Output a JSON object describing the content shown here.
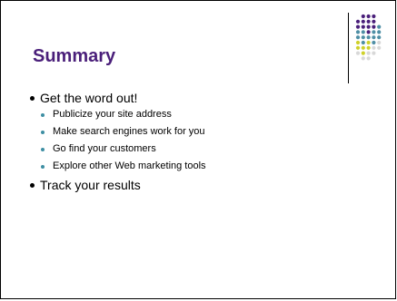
{
  "slide": {
    "title": "Summary",
    "bullets": [
      {
        "text": "Get the word out!",
        "sub": [
          "Publicize your site address",
          "Make search engines work for you",
          "Go find your customers",
          "Explore other Web marketing tools"
        ]
      },
      {
        "text": "Track your results",
        "sub": []
      }
    ]
  },
  "decoration": {
    "dot_grid_icon": "dot-grid",
    "colors": {
      "purple": "#4a1f7a",
      "teal": "#4f8fa5",
      "yellow": "#cfd12a",
      "gray": "#d8d8d8",
      "bullet_teal": "#3e8fa3"
    }
  }
}
